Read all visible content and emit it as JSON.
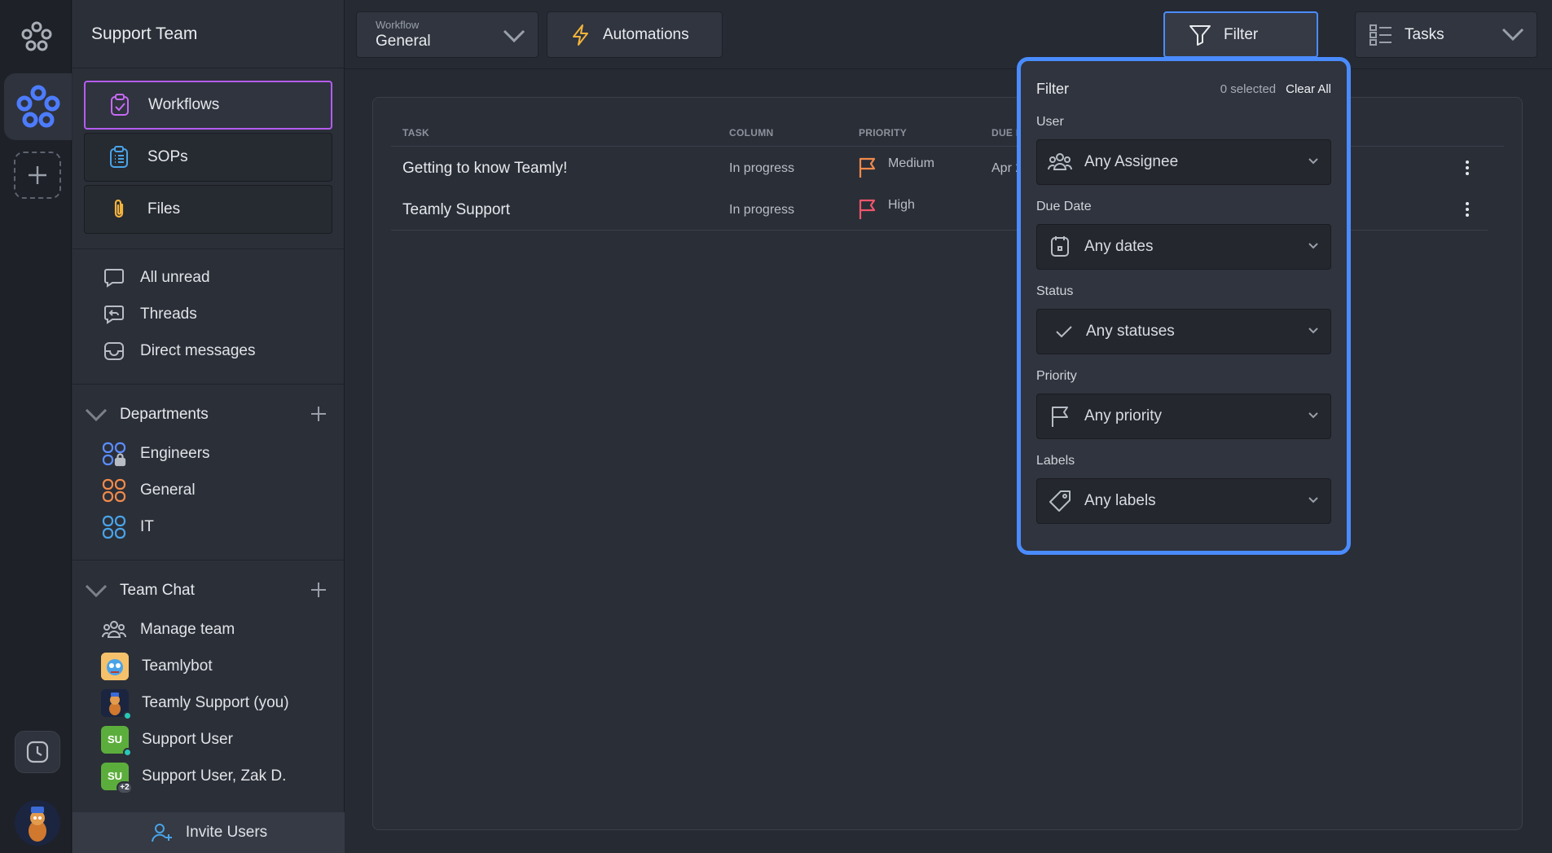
{
  "workspace": {
    "name": "Support Team"
  },
  "main_nav": [
    {
      "label": "Workflows",
      "icon": "clipboard-check-icon",
      "active": true
    },
    {
      "label": "SOPs",
      "icon": "clipboard-list-icon",
      "active": false
    },
    {
      "label": "Files",
      "icon": "paperclip-icon",
      "active": false
    }
  ],
  "inbox": [
    {
      "label": "All unread",
      "icon": "chat-bubble-icon"
    },
    {
      "label": "Threads",
      "icon": "thread-reply-icon"
    },
    {
      "label": "Direct messages",
      "icon": "inbox-icon"
    }
  ],
  "departments": {
    "title": "Departments",
    "items": [
      {
        "label": "Engineers",
        "color": "#5b8dff",
        "locked": true
      },
      {
        "label": "General",
        "color": "#f08a4b",
        "locked": false
      },
      {
        "label": "IT",
        "color": "#4aa3e8",
        "locked": false
      }
    ]
  },
  "team_chat": {
    "title": "Team Chat",
    "items": [
      {
        "label": "Manage team",
        "avatar": "people-icon"
      },
      {
        "label": "Teamlybot",
        "avatar": "teamlybot-avatar"
      },
      {
        "label": "Teamly Support (you)",
        "avatar": "support-avatar"
      },
      {
        "label": "Support User",
        "initials": "SU",
        "badge": ""
      },
      {
        "label": "Support User, Zak D.",
        "initials": "SU",
        "badge": "+2"
      }
    ]
  },
  "invite": {
    "label": "Invite Users"
  },
  "topbar": {
    "workflow_caption": "Workflow",
    "workflow_value": "General",
    "automations_label": "Automations",
    "filter_label": "Filter",
    "view_label": "Tasks"
  },
  "table": {
    "headers": {
      "task": "TASK",
      "column": "COLUMN",
      "priority": "PRIORITY",
      "due": "DUE D"
    },
    "rows": [
      {
        "task": "Getting to know Teamly!",
        "column": "In progress",
        "priority": "Medium",
        "priority_color": "#f08a4b",
        "due": "Apr 2"
      },
      {
        "task": "Teamly Support",
        "column": "In progress",
        "priority": "High",
        "priority_color": "#f0566a",
        "due": ""
      }
    ]
  },
  "filter_panel": {
    "title": "Filter",
    "selected_count": "0 selected",
    "clear_label": "Clear All",
    "fields": [
      {
        "label": "User",
        "value": "Any Assignee",
        "icon": "users-icon"
      },
      {
        "label": "Due Date",
        "value": "Any dates",
        "icon": "calendar-icon"
      },
      {
        "label": "Status",
        "value": "Any statuses",
        "icon": "check-icon"
      },
      {
        "label": "Priority",
        "value": "Any priority",
        "icon": "flag-icon"
      },
      {
        "label": "Labels",
        "value": "Any labels",
        "icon": "tag-icon"
      }
    ]
  },
  "colors": {
    "accent": "#4a8cff",
    "active_border": "#b45cf0",
    "sidebar_bg": "#2b2f38",
    "app_bg": "#262a33"
  }
}
